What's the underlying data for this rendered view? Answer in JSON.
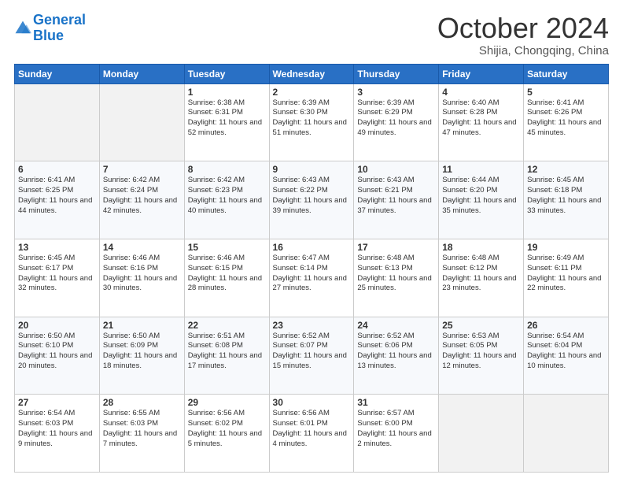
{
  "logo": {
    "line1": "General",
    "line2": "Blue"
  },
  "header": {
    "month": "October 2024",
    "location": "Shijia, Chongqing, China"
  },
  "weekdays": [
    "Sunday",
    "Monday",
    "Tuesday",
    "Wednesday",
    "Thursday",
    "Friday",
    "Saturday"
  ],
  "weeks": [
    [
      {
        "day": "",
        "sunrise": "",
        "sunset": "",
        "daylight": ""
      },
      {
        "day": "",
        "sunrise": "",
        "sunset": "",
        "daylight": ""
      },
      {
        "day": "1",
        "sunrise": "Sunrise: 6:38 AM",
        "sunset": "Sunset: 6:31 PM",
        "daylight": "Daylight: 11 hours and 52 minutes."
      },
      {
        "day": "2",
        "sunrise": "Sunrise: 6:39 AM",
        "sunset": "Sunset: 6:30 PM",
        "daylight": "Daylight: 11 hours and 51 minutes."
      },
      {
        "day": "3",
        "sunrise": "Sunrise: 6:39 AM",
        "sunset": "Sunset: 6:29 PM",
        "daylight": "Daylight: 11 hours and 49 minutes."
      },
      {
        "day": "4",
        "sunrise": "Sunrise: 6:40 AM",
        "sunset": "Sunset: 6:28 PM",
        "daylight": "Daylight: 11 hours and 47 minutes."
      },
      {
        "day": "5",
        "sunrise": "Sunrise: 6:41 AM",
        "sunset": "Sunset: 6:26 PM",
        "daylight": "Daylight: 11 hours and 45 minutes."
      }
    ],
    [
      {
        "day": "6",
        "sunrise": "Sunrise: 6:41 AM",
        "sunset": "Sunset: 6:25 PM",
        "daylight": "Daylight: 11 hours and 44 minutes."
      },
      {
        "day": "7",
        "sunrise": "Sunrise: 6:42 AM",
        "sunset": "Sunset: 6:24 PM",
        "daylight": "Daylight: 11 hours and 42 minutes."
      },
      {
        "day": "8",
        "sunrise": "Sunrise: 6:42 AM",
        "sunset": "Sunset: 6:23 PM",
        "daylight": "Daylight: 11 hours and 40 minutes."
      },
      {
        "day": "9",
        "sunrise": "Sunrise: 6:43 AM",
        "sunset": "Sunset: 6:22 PM",
        "daylight": "Daylight: 11 hours and 39 minutes."
      },
      {
        "day": "10",
        "sunrise": "Sunrise: 6:43 AM",
        "sunset": "Sunset: 6:21 PM",
        "daylight": "Daylight: 11 hours and 37 minutes."
      },
      {
        "day": "11",
        "sunrise": "Sunrise: 6:44 AM",
        "sunset": "Sunset: 6:20 PM",
        "daylight": "Daylight: 11 hours and 35 minutes."
      },
      {
        "day": "12",
        "sunrise": "Sunrise: 6:45 AM",
        "sunset": "Sunset: 6:18 PM",
        "daylight": "Daylight: 11 hours and 33 minutes."
      }
    ],
    [
      {
        "day": "13",
        "sunrise": "Sunrise: 6:45 AM",
        "sunset": "Sunset: 6:17 PM",
        "daylight": "Daylight: 11 hours and 32 minutes."
      },
      {
        "day": "14",
        "sunrise": "Sunrise: 6:46 AM",
        "sunset": "Sunset: 6:16 PM",
        "daylight": "Daylight: 11 hours and 30 minutes."
      },
      {
        "day": "15",
        "sunrise": "Sunrise: 6:46 AM",
        "sunset": "Sunset: 6:15 PM",
        "daylight": "Daylight: 11 hours and 28 minutes."
      },
      {
        "day": "16",
        "sunrise": "Sunrise: 6:47 AM",
        "sunset": "Sunset: 6:14 PM",
        "daylight": "Daylight: 11 hours and 27 minutes."
      },
      {
        "day": "17",
        "sunrise": "Sunrise: 6:48 AM",
        "sunset": "Sunset: 6:13 PM",
        "daylight": "Daylight: 11 hours and 25 minutes."
      },
      {
        "day": "18",
        "sunrise": "Sunrise: 6:48 AM",
        "sunset": "Sunset: 6:12 PM",
        "daylight": "Daylight: 11 hours and 23 minutes."
      },
      {
        "day": "19",
        "sunrise": "Sunrise: 6:49 AM",
        "sunset": "Sunset: 6:11 PM",
        "daylight": "Daylight: 11 hours and 22 minutes."
      }
    ],
    [
      {
        "day": "20",
        "sunrise": "Sunrise: 6:50 AM",
        "sunset": "Sunset: 6:10 PM",
        "daylight": "Daylight: 11 hours and 20 minutes."
      },
      {
        "day": "21",
        "sunrise": "Sunrise: 6:50 AM",
        "sunset": "Sunset: 6:09 PM",
        "daylight": "Daylight: 11 hours and 18 minutes."
      },
      {
        "day": "22",
        "sunrise": "Sunrise: 6:51 AM",
        "sunset": "Sunset: 6:08 PM",
        "daylight": "Daylight: 11 hours and 17 minutes."
      },
      {
        "day": "23",
        "sunrise": "Sunrise: 6:52 AM",
        "sunset": "Sunset: 6:07 PM",
        "daylight": "Daylight: 11 hours and 15 minutes."
      },
      {
        "day": "24",
        "sunrise": "Sunrise: 6:52 AM",
        "sunset": "Sunset: 6:06 PM",
        "daylight": "Daylight: 11 hours and 13 minutes."
      },
      {
        "day": "25",
        "sunrise": "Sunrise: 6:53 AM",
        "sunset": "Sunset: 6:05 PM",
        "daylight": "Daylight: 11 hours and 12 minutes."
      },
      {
        "day": "26",
        "sunrise": "Sunrise: 6:54 AM",
        "sunset": "Sunset: 6:04 PM",
        "daylight": "Daylight: 11 hours and 10 minutes."
      }
    ],
    [
      {
        "day": "27",
        "sunrise": "Sunrise: 6:54 AM",
        "sunset": "Sunset: 6:03 PM",
        "daylight": "Daylight: 11 hours and 9 minutes."
      },
      {
        "day": "28",
        "sunrise": "Sunrise: 6:55 AM",
        "sunset": "Sunset: 6:03 PM",
        "daylight": "Daylight: 11 hours and 7 minutes."
      },
      {
        "day": "29",
        "sunrise": "Sunrise: 6:56 AM",
        "sunset": "Sunset: 6:02 PM",
        "daylight": "Daylight: 11 hours and 5 minutes."
      },
      {
        "day": "30",
        "sunrise": "Sunrise: 6:56 AM",
        "sunset": "Sunset: 6:01 PM",
        "daylight": "Daylight: 11 hours and 4 minutes."
      },
      {
        "day": "31",
        "sunrise": "Sunrise: 6:57 AM",
        "sunset": "Sunset: 6:00 PM",
        "daylight": "Daylight: 11 hours and 2 minutes."
      },
      {
        "day": "",
        "sunrise": "",
        "sunset": "",
        "daylight": ""
      },
      {
        "day": "",
        "sunrise": "",
        "sunset": "",
        "daylight": ""
      }
    ]
  ]
}
